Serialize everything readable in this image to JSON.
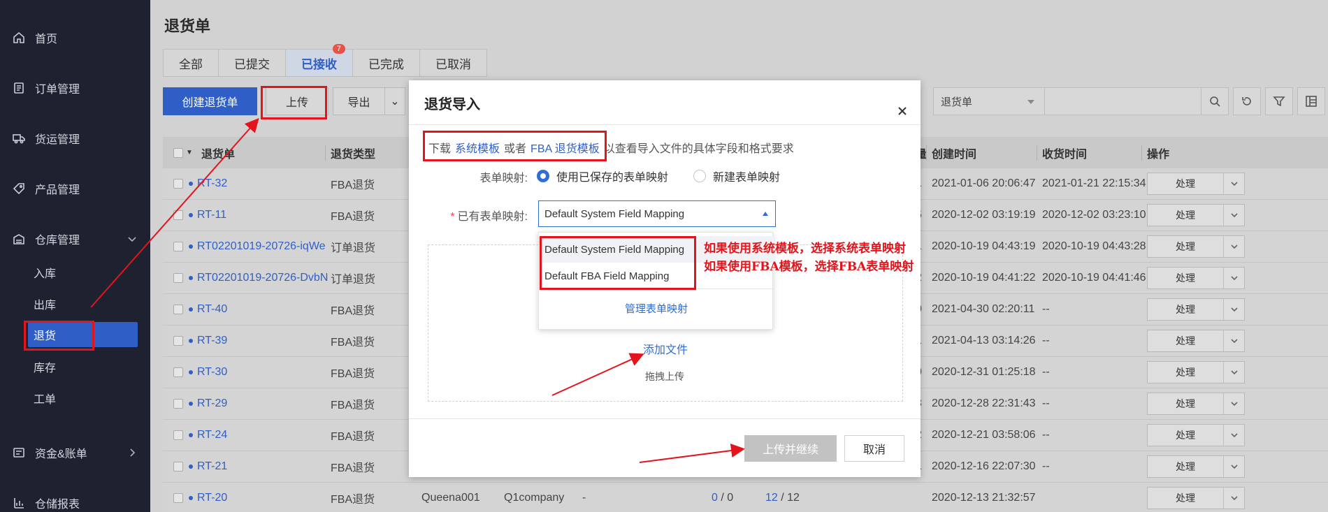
{
  "sidebar": {
    "items": [
      {
        "label": "首页",
        "icon": "home-icon"
      },
      {
        "label": "订单管理",
        "icon": "order-icon"
      },
      {
        "label": "货运管理",
        "icon": "truck-icon"
      },
      {
        "label": "产品管理",
        "icon": "tag-icon"
      },
      {
        "label": "仓库管理",
        "icon": "warehouse-icon"
      },
      {
        "label": "资金&账单",
        "icon": "finance-icon"
      },
      {
        "label": "仓储报表",
        "icon": "report-icon"
      }
    ],
    "sub_items": [
      "入库",
      "出库",
      "退货",
      "库存",
      "工单"
    ]
  },
  "page": {
    "title": "退货单",
    "tabs": [
      "全部",
      "已提交",
      "已接收",
      "已完成",
      "已取消"
    ],
    "active_tab_badge": "7"
  },
  "toolbar": {
    "create_label": "创建退货单",
    "upload_label": "上传",
    "export_label": "导出",
    "search_type": "退货单"
  },
  "table": {
    "headers": [
      "退货单",
      "退货类型",
      "量",
      "创建时间",
      "收货时间",
      "操作"
    ],
    "rows": [
      {
        "id": "RT-32",
        "type": "FBA退货",
        "qty": "1",
        "created": "2021-01-06 20:06:47",
        "received": "2021-01-21 22:15:34"
      },
      {
        "id": "RT-11",
        "type": "FBA退货",
        "qty": "6",
        "created": "2020-12-02 03:19:19",
        "received": "2020-12-02 03:23:10"
      },
      {
        "id": "RT02201019-20726-iqWe",
        "type": "订单退货",
        "qty": "1",
        "created": "2020-10-19 04:43:19",
        "received": "2020-10-19 04:43:28"
      },
      {
        "id": "RT02201019-20726-DvbN",
        "type": "订单退货",
        "qty": "2",
        "created": "2020-10-19 04:41:22",
        "received": "2020-10-19 04:41:46"
      },
      {
        "id": "RT-40",
        "type": "FBA退货",
        "qty": "0",
        "created": "2021-04-30 02:20:11",
        "received": "--"
      },
      {
        "id": "RT-39",
        "type": "FBA退货",
        "qty": "1",
        "created": "2021-04-13 03:14:26",
        "received": "--"
      },
      {
        "id": "RT-30",
        "type": "FBA退货",
        "qty": "0",
        "created": "2020-12-31 01:25:18",
        "received": "--"
      },
      {
        "id": "RT-29",
        "type": "FBA退货",
        "qty": "3",
        "created": "2020-12-28 22:31:43",
        "received": "--"
      },
      {
        "id": "RT-24",
        "type": "FBA退货",
        "qty": "2",
        "created": "2020-12-21 03:58:06",
        "received": "--"
      },
      {
        "id": "RT-21",
        "type": "FBA退货",
        "qty": "1",
        "created": "2020-12-16 22:07:30",
        "received": "--"
      }
    ],
    "last_row": {
      "id": "RT-20",
      "type": "FBA退货",
      "customer": "Queena001",
      "company": "Q1company",
      "dash": "-",
      "a1": "0",
      "a2": "0",
      "b1": "12",
      "b2": "12",
      "created": "2020-12-13 21:32:57"
    },
    "op_label": "处理"
  },
  "modal": {
    "title": "退货导入",
    "download_prefix": "下载",
    "sys_template": "系统模板",
    "or": "或者",
    "fba_template": "FBA 退货模板",
    "download_suffix": "以查看导入文件的具体字段和格式要求",
    "mapping_label": "表单映射:",
    "radio_saved": "使用已保存的表单映射",
    "radio_new": "新建表单映射",
    "existing_label": "已有表单映射:",
    "selected_mapping": "Default System Field Mapping",
    "options": [
      "Default System Field Mapping",
      "Default FBA Field Mapping"
    ],
    "manage_label": "管理表单映射",
    "add_file": "添加文件",
    "drag_hint": "拖拽上传",
    "continue_label": "上传并继续",
    "cancel_label": "取消"
  },
  "annotations": {
    "note_line1": "如果使用系统模板，选择系统表单映射",
    "note_line2": "如果使用FBA模板，选择FBA表单映射",
    "color": "#e3141c"
  }
}
